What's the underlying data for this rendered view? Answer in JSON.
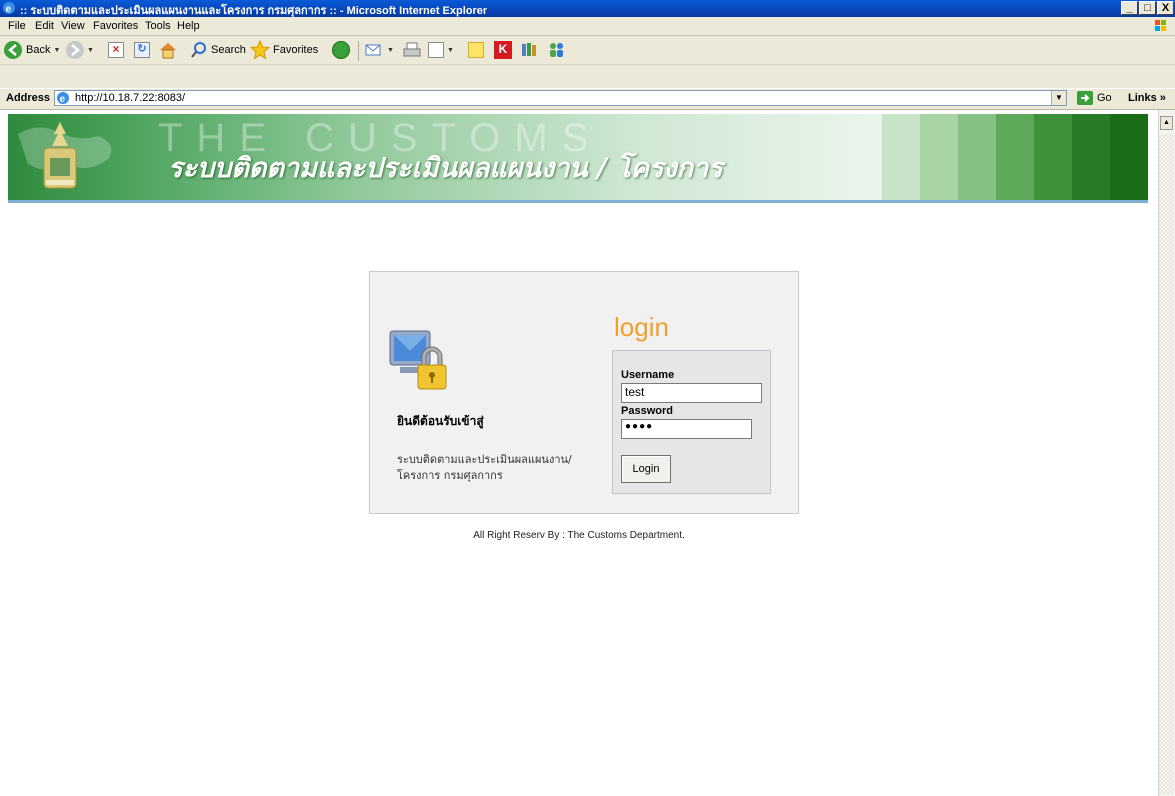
{
  "window": {
    "title": ":: ระบบติดตามและประเมินผลแผนงานและโครงการ กรมศุลกากร :: - Microsoft Internet Explorer",
    "minimize": "_",
    "maximize": "□",
    "close": "X"
  },
  "menu": {
    "items": [
      "File",
      "Edit",
      "View",
      "Favorites",
      "Tools",
      "Help"
    ]
  },
  "toolbar": {
    "back_label": "Back",
    "search_label": "Search",
    "favorites_label": "Favorites"
  },
  "address": {
    "label": "Address",
    "url": "http://10.18.7.22:8083/",
    "go_label": "Go",
    "links_label": "Links »"
  },
  "banner": {
    "watermark": "THE CUSTOMS",
    "title": "ระบบติดตามและประเมินผลแผนงาน / โครงการ",
    "stripe_colors": [
      "#c9e3c9",
      "#a9d4a6",
      "#86c184",
      "#5ea85a",
      "#3f8f3b",
      "#2a7a28",
      "#1a6c18"
    ]
  },
  "login": {
    "title": "login",
    "welcome": "ยินดีต้อนรับเข้าสู่",
    "description": "ระบบติดตามและประเมินผลแผนงาน/โครงการ กรมศุลกากร",
    "username_label": "Username",
    "username_value": "test",
    "password_label": "Password",
    "password_value": "●●●●",
    "button_label": "Login"
  },
  "footer": {
    "text": "All Right Reserv By : The Customs Department."
  },
  "colors": {
    "accent_orange": "#f0a030",
    "titlebar_blue": "#0a5ad8"
  }
}
